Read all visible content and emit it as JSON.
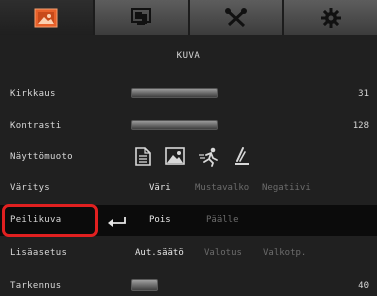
{
  "tabs": [
    {
      "name": "picture-tab-icon",
      "active": true
    },
    {
      "name": "display-tab-icon",
      "active": false
    },
    {
      "name": "tools-tab-icon",
      "active": false
    },
    {
      "name": "settings-gear-icon",
      "active": false
    }
  ],
  "section_title": "KUVA",
  "rows": {
    "kirkkaus": {
      "label": "Kirkkaus",
      "value": "31"
    },
    "kontrasti": {
      "label": "Kontrasti",
      "value": "128"
    },
    "nayttomuoto": {
      "label": "Näyttömuoto"
    },
    "varitys": {
      "label": "Väritys",
      "options": [
        "Väri",
        "Mustavalko",
        "Negatiivi"
      ]
    },
    "peilikuva": {
      "label": "Peilikuva",
      "options": [
        "Pois",
        "Päälle"
      ]
    },
    "lisaasetus": {
      "label": "Lisäasetus",
      "options": [
        "Aut.säätö",
        "Valotus",
        "Valkotp."
      ]
    },
    "tarkennus": {
      "label": "Tarkennus",
      "value": "40"
    }
  },
  "colors": {
    "accent_orange": "#e8612a",
    "highlight_red": "#e02020"
  }
}
